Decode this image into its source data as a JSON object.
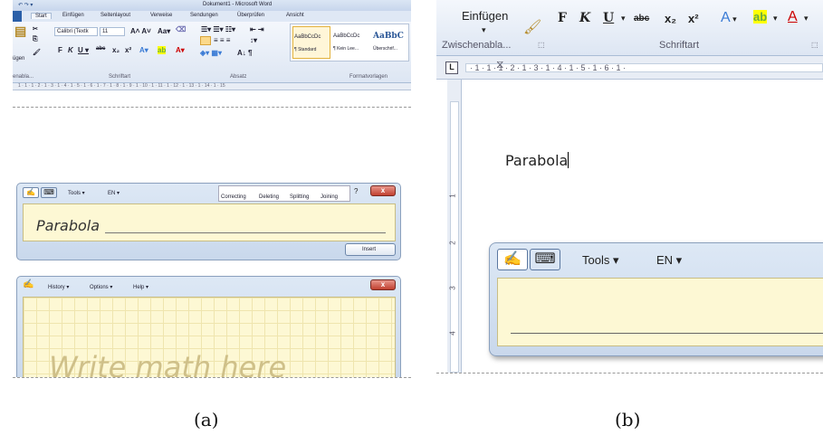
{
  "caption_a": "(a)",
  "caption_b": "(b)",
  "a": {
    "title": "Dokument1 - Microsoft Word",
    "tabs": [
      "Start",
      "Einfügen",
      "Seitenlayout",
      "Verweise",
      "Sendungen",
      "Überprüfen",
      "Ansicht"
    ],
    "font_name": "Calibri (Textk",
    "font_size": "11",
    "groups": [
      "enabla...",
      "Schriftart",
      "Absatz",
      "Formatvorlagen"
    ],
    "paste_label": "ügen",
    "styles": [
      {
        "preview": "AaBbCcDc",
        "name": "¶ Standard"
      },
      {
        "preview": "AaBbCcDc",
        "name": "¶ Kein Lee..."
      },
      {
        "preview": "AaBbC",
        "name": "Überschrif..."
      }
    ],
    "ruler_marks": "1 · 1 · 1 · 2 · 1 · 3 · 1 · 4 · 1 · 5 · 1 · 6 · 1 · 7 · 1 · 8 · 1 · 9 · 1 · 10 · 1 · 11 · 1 · 12 · 1 · 13 · 1 · 14 · 1 · 15",
    "tip": {
      "tools": "Tools",
      "lang": "EN",
      "actions": [
        "Correcting",
        "Deleting",
        "Splitting",
        "Joining"
      ],
      "ink_text": "Parabola",
      "insert": "Insert"
    },
    "math": {
      "menus": [
        "History",
        "Options",
        "Help"
      ],
      "placeholder": "Write math here"
    }
  },
  "b": {
    "paste": "Einfügen",
    "font_buttons": [
      "F",
      "K",
      "U",
      "abc",
      "x₂",
      "x²"
    ],
    "clipboard_group": "Zwischenabla...",
    "font_group": "Schriftart",
    "ruler_marks": "· 1 · 1 · 1 · 2 · 1 · 3 · 1 · 4 · 1 · 5 · 1 · 6 · 1 ·",
    "doc_text": "Parabola",
    "vruler_marks": [
      "1",
      "2",
      "3",
      "4"
    ],
    "tip": {
      "tools": "Tools",
      "lang": "EN"
    }
  }
}
